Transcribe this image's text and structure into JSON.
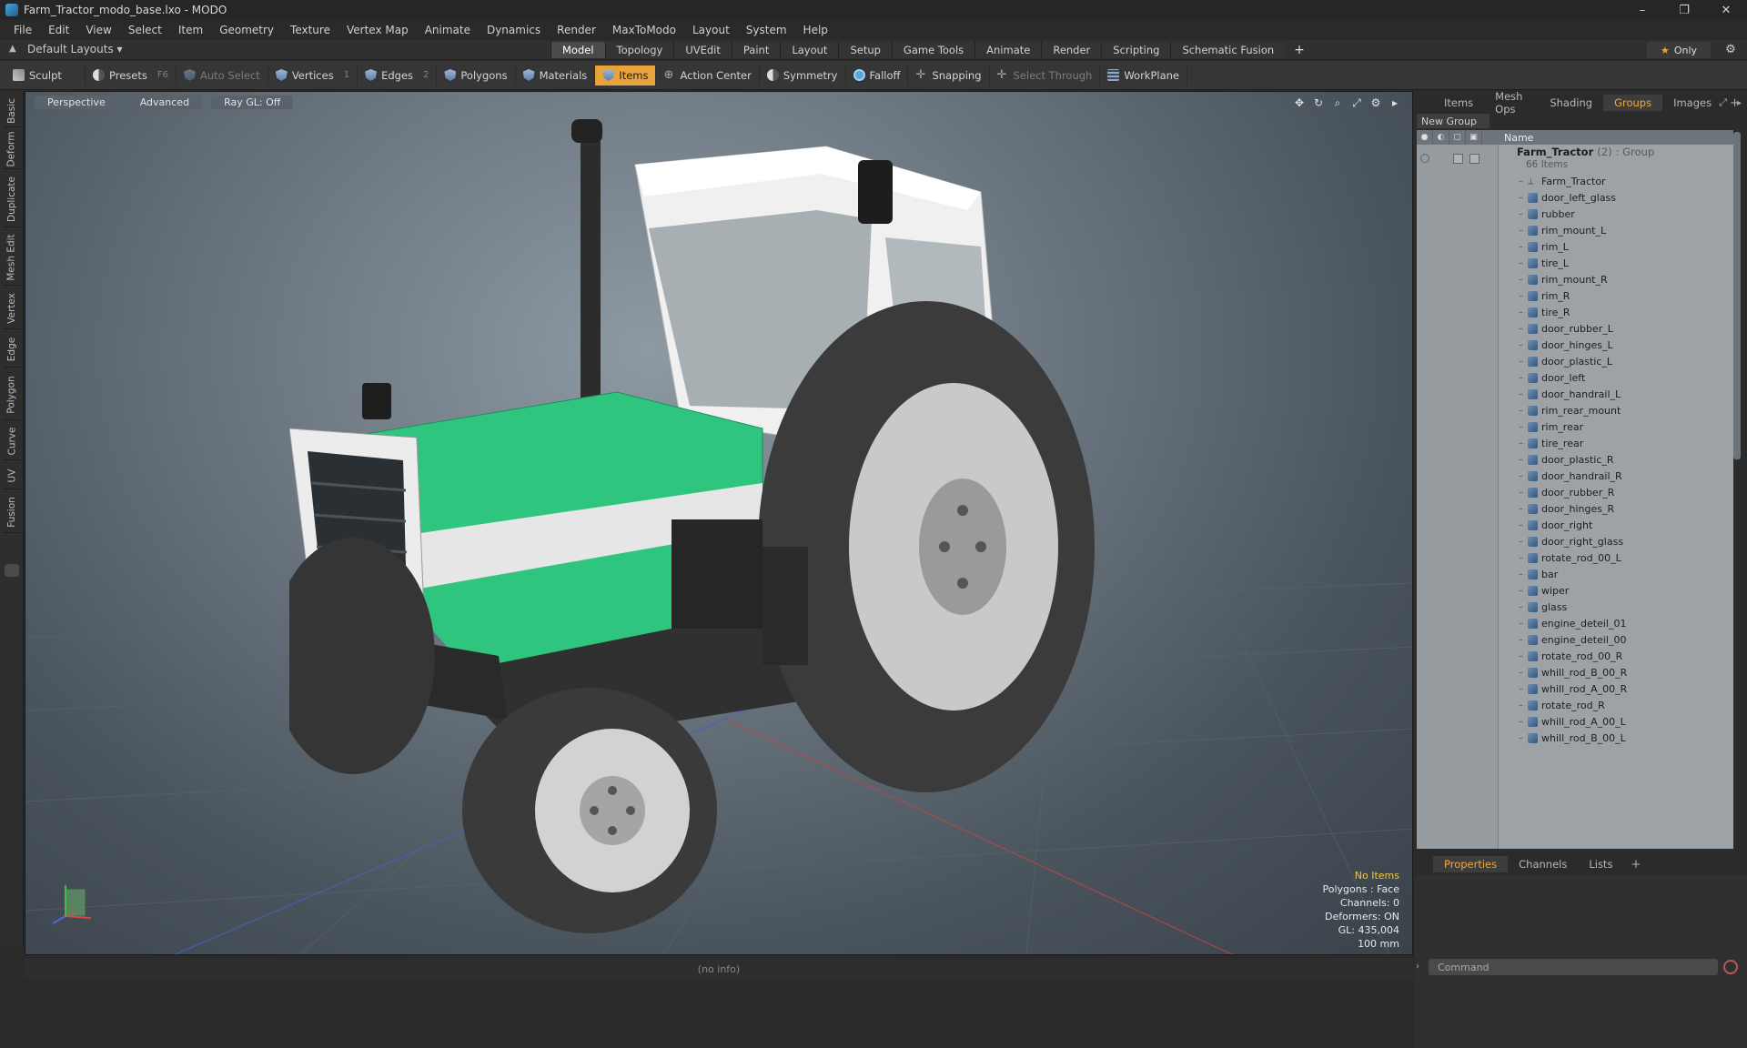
{
  "window": {
    "title": "Farm_Tractor_modo_base.lxo - MODO",
    "controls": [
      "–",
      "❐",
      "✕"
    ]
  },
  "menu": [
    "File",
    "Edit",
    "View",
    "Select",
    "Item",
    "Geometry",
    "Texture",
    "Vertex Map",
    "Animate",
    "Dynamics",
    "Render",
    "MaxToModo",
    "Layout",
    "System",
    "Help"
  ],
  "layout": {
    "name": "Default Layouts ▾",
    "tabs": [
      "Model",
      "Topology",
      "UVEdit",
      "Paint",
      "Layout",
      "Setup",
      "Game Tools",
      "Animate",
      "Render",
      "Scripting",
      "Schematic Fusion"
    ],
    "active_tab": "Model",
    "add": "+",
    "only_label": "Only"
  },
  "toolbar": {
    "sculpt": "Sculpt",
    "presets": "Presets",
    "presets_key": "F6",
    "auto_select": "Auto Select",
    "vertices": "Vertices",
    "vertices_key": "1",
    "edges": "Edges",
    "edges_key": "2",
    "polygons": "Polygons",
    "materials": "Materials",
    "items": "Items",
    "action_center": "Action Center",
    "symmetry": "Symmetry",
    "falloff": "Falloff",
    "snapping": "Snapping",
    "select_through": "Select Through",
    "workplane": "WorkPlane"
  },
  "left_tabs": [
    "Basic",
    "Deform",
    "Duplicate",
    "Mesh Edit",
    "Vertex",
    "Edge",
    "Polygon",
    "Curve",
    "UV",
    "Fusion"
  ],
  "viewport": {
    "view": "Perspective",
    "mode": "Advanced",
    "raygl": "Ray GL: Off",
    "info": {
      "selection": "No Items",
      "polygons": "Polygons : Face",
      "channels": "Channels: 0",
      "deformers": "Deformers: ON",
      "gl": "GL: 435,004",
      "scale": "100 mm"
    },
    "colors": {
      "tractor_green": "#2fc57f",
      "tractor_white": "#e6e6e6",
      "tire": "#3a3a3a"
    }
  },
  "right_panel": {
    "tabs": [
      "Items",
      "Mesh Ops",
      "Shading",
      "Groups",
      "Images"
    ],
    "active_tab": "Groups",
    "new_group": "New Group",
    "name_header": "Name",
    "group": {
      "name": "Farm_Tractor",
      "count": "(2)",
      "type": ": Group",
      "sub": "66 Items"
    },
    "items": [
      {
        "name": "Farm_Tractor",
        "kind": "locator"
      },
      {
        "name": "door_left_glass",
        "kind": "mesh"
      },
      {
        "name": "rubber",
        "kind": "mesh"
      },
      {
        "name": "rim_mount_L",
        "kind": "mesh"
      },
      {
        "name": "rim_L",
        "kind": "mesh"
      },
      {
        "name": "tire_L",
        "kind": "mesh"
      },
      {
        "name": "rim_mount_R",
        "kind": "mesh"
      },
      {
        "name": "rim_R",
        "kind": "mesh"
      },
      {
        "name": "tire_R",
        "kind": "mesh"
      },
      {
        "name": "door_rubber_L",
        "kind": "mesh"
      },
      {
        "name": "door_hinges_L",
        "kind": "mesh"
      },
      {
        "name": "door_plastic_L",
        "kind": "mesh"
      },
      {
        "name": "door_left",
        "kind": "mesh"
      },
      {
        "name": "door_handrail_L",
        "kind": "mesh"
      },
      {
        "name": "rim_rear_mount",
        "kind": "mesh"
      },
      {
        "name": "rim_rear",
        "kind": "mesh"
      },
      {
        "name": "tire_rear",
        "kind": "mesh"
      },
      {
        "name": "door_plastic_R",
        "kind": "mesh"
      },
      {
        "name": "door_handrail_R",
        "kind": "mesh"
      },
      {
        "name": "door_rubber_R",
        "kind": "mesh"
      },
      {
        "name": "door_hinges_R",
        "kind": "mesh"
      },
      {
        "name": "door_right",
        "kind": "mesh"
      },
      {
        "name": "door_right_glass",
        "kind": "mesh"
      },
      {
        "name": "rotate_rod_00_L",
        "kind": "mesh"
      },
      {
        "name": "bar",
        "kind": "mesh"
      },
      {
        "name": "wiper",
        "kind": "mesh"
      },
      {
        "name": "glass",
        "kind": "mesh"
      },
      {
        "name": "engine_deteil_01",
        "kind": "mesh"
      },
      {
        "name": "engine_deteil_00",
        "kind": "mesh"
      },
      {
        "name": "rotate_rod_00_R",
        "kind": "mesh"
      },
      {
        "name": "whill_rod_B_00_R",
        "kind": "mesh"
      },
      {
        "name": "whill_rod_A_00_R",
        "kind": "mesh"
      },
      {
        "name": "rotate_rod_R",
        "kind": "mesh"
      },
      {
        "name": "whill_rod_A_00_L",
        "kind": "mesh"
      },
      {
        "name": "whill_rod_B_00_L",
        "kind": "mesh"
      }
    ],
    "bottom_tabs": [
      "Properties",
      "Channels",
      "Lists"
    ],
    "bottom_active": "Properties"
  },
  "status": {
    "info": "(no info)"
  },
  "command": {
    "placeholder": "Command"
  }
}
